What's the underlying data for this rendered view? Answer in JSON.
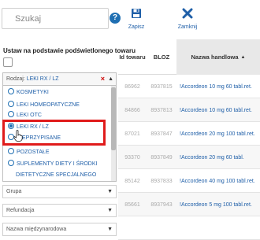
{
  "search": {
    "placeholder": "Szukaj"
  },
  "help": {
    "label": "?"
  },
  "toolbar": {
    "save_label": "Zapisz",
    "close_label": "Zamknij"
  },
  "section": {
    "label": "Ustaw na podstawie podświetlonego towaru"
  },
  "dropdown": {
    "prefix": "Rodzaj: ",
    "value": "LEKI RX / LZ",
    "clear": "×",
    "arrow": "▲",
    "items": [
      {
        "label": "KOSMETYKI"
      },
      {
        "label": "LEKI HOMEOPATYCZNE"
      },
      {
        "label": "LEKI OTC"
      },
      {
        "label": "LEKI RX / LZ"
      },
      {
        "label": "NIEPRZYPISANE"
      },
      {
        "label": "POZOSTAŁE"
      },
      {
        "label": "SUPLEMENTY DIETY I ŚRODKI"
      },
      {
        "label": "DIETETYCZNE SPECJALNEGO"
      }
    ]
  },
  "filters": [
    {
      "label": "Grupa",
      "arrow": "▼"
    },
    {
      "label": "Refundacja",
      "arrow": "▼"
    },
    {
      "label": "Nazwa międzynarodowa",
      "arrow": "▼"
    }
  ],
  "table": {
    "headers": {
      "id": "Id towaru",
      "bloz": "BLOZ",
      "name": "Nazwa handlowa",
      "sort": "▲"
    },
    "rows": [
      {
        "id": "86962",
        "bloz": "8937815",
        "name": "!Accordeon 10 mg 60 tabl.ret."
      },
      {
        "id": "84866",
        "bloz": "8937813",
        "name": "!Accordeon 10 mg 60 tabl.ret."
      },
      {
        "id": "87021",
        "bloz": "8937847",
        "name": "!Accordeon 20 mg 100 tabl.ret."
      },
      {
        "id": "93370",
        "bloz": "8937849",
        "name": "!Accordeon 20 mg 60 tabl."
      },
      {
        "id": "85142",
        "bloz": "8937833",
        "name": "!Accordeon 40 mg 100 tabl.ret."
      },
      {
        "id": "85661",
        "bloz": "8937943",
        "name": "!Accordeon 5 mg 100 tabl.ret."
      },
      {
        "id": "",
        "bloz": "",
        "name": ""
      }
    ]
  },
  "colors": {
    "accent": "#1f6fb2",
    "highlight": "#e01b1b",
    "link": "#1f5fa8"
  }
}
